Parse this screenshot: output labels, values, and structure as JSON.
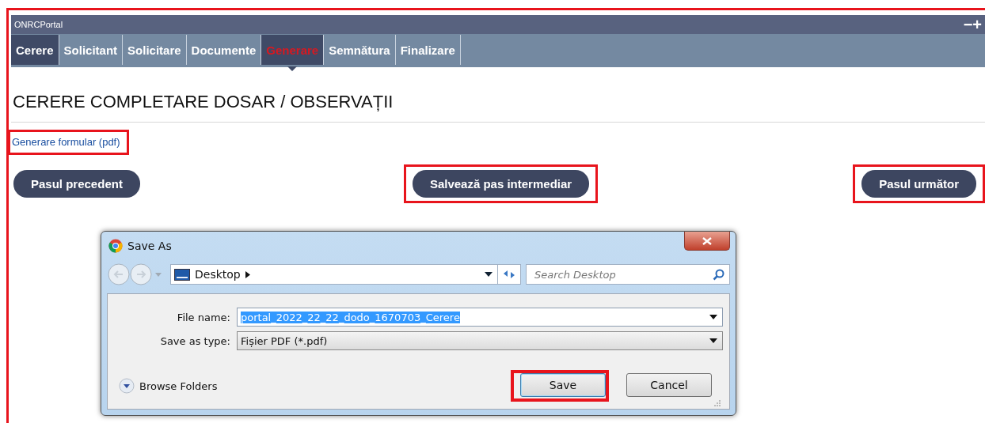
{
  "portal": {
    "title": "ONRCPortal",
    "window_controls": [
      "−",
      "+"
    ],
    "framed": true
  },
  "tabs": [
    {
      "label": "Cerere",
      "selected": false,
      "done": true
    },
    {
      "label": "Solicitant",
      "selected": false,
      "done": false
    },
    {
      "label": "Solicitare",
      "selected": false,
      "done": false
    },
    {
      "label": "Documente",
      "selected": false,
      "done": false
    },
    {
      "label": "Generare",
      "selected": true,
      "done": false
    },
    {
      "label": "Semnătura",
      "selected": false,
      "done": false
    },
    {
      "label": "Finalizare",
      "selected": false,
      "done": false
    }
  ],
  "heading": "CERERE COMPLETARE DOSAR / OBSERVAȚII",
  "link": {
    "label": "Generare formular (pdf)",
    "highlighted": true
  },
  "buttons": [
    {
      "label": "Pasul precedent",
      "highlighted": false
    },
    {
      "label": "Salvează pas intermediar",
      "highlighted": true
    },
    {
      "label": "Pasul următor",
      "highlighted": true
    }
  ],
  "dialog": {
    "title": "Save As",
    "location": "Desktop",
    "search": {
      "placeholder": "Search Desktop"
    },
    "fields": [
      {
        "label": "File name:",
        "value": "portal_2022_22_22_dodo_1670703_Cerere",
        "kind": "text"
      },
      {
        "label": "Save as type:",
        "value": "Fișier PDF (*.pdf)",
        "kind": "select"
      }
    ],
    "browse": "Browse Folders",
    "actions": [
      {
        "label": "Save",
        "highlighted": true
      },
      {
        "label": "Cancel",
        "highlighted": false
      }
    ]
  }
}
